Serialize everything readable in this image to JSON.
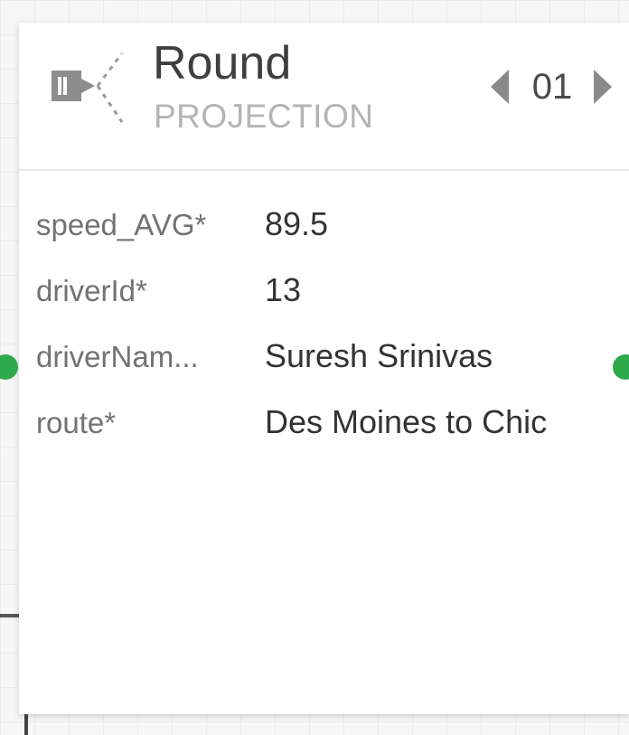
{
  "node": {
    "title": "Round",
    "subtitle": "PROJECTION",
    "icon": "projection-icon",
    "pager": {
      "value": "01",
      "prev_icon": "triangle-left-icon",
      "next_icon": "triangle-right-icon"
    }
  },
  "fields": [
    {
      "name": "speed_AVG*",
      "value": "89.5"
    },
    {
      "name": "driverId*",
      "value": "13"
    },
    {
      "name": "driverNam...",
      "value": "Suresh Srinivas"
    },
    {
      "name": "route*",
      "value": "Des Moines to Chic"
    }
  ],
  "ports": {
    "color": "#2faa4a",
    "input_icon": "input-port-icon",
    "output_icon": "output-port-icon"
  }
}
